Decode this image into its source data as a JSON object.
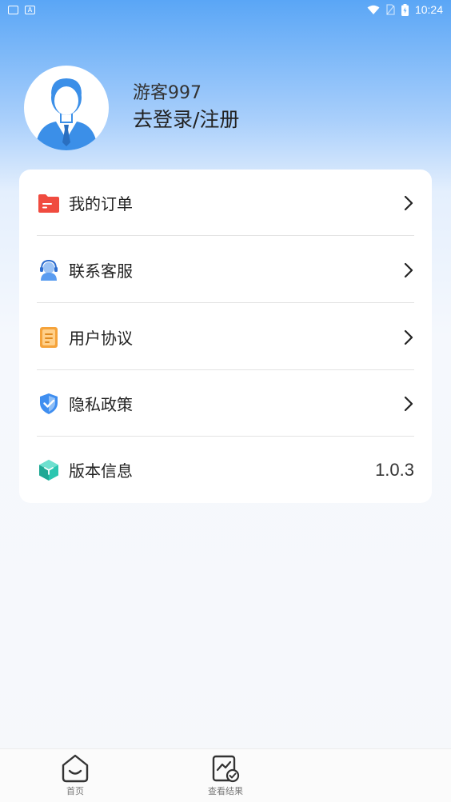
{
  "status_bar": {
    "time": "10:24",
    "left_icons": [
      "mail-icon",
      "a-app-icon"
    ],
    "right_icons": [
      "wifi-icon",
      "no-sim-icon",
      "battery-charging-icon"
    ]
  },
  "profile": {
    "username": "游客997",
    "login_link": "去登录/注册"
  },
  "menu": {
    "items": [
      {
        "label": "我的订单",
        "icon": "orders-folder-icon",
        "icon_color": "#f04b3f"
      },
      {
        "label": "联系客服",
        "icon": "customer-service-icon",
        "icon_color": "#5a9cf0"
      },
      {
        "label": "用户协议",
        "icon": "document-icon",
        "icon_color": "#f5a33a"
      },
      {
        "label": "隐私政策",
        "icon": "shield-check-icon",
        "icon_color": "#3f8ef0"
      },
      {
        "label": "版本信息",
        "icon": "cube-icon",
        "icon_color": "#2cc6b0",
        "value": "1.0.3"
      }
    ]
  },
  "tab_bar": {
    "tabs": [
      {
        "label": "首页",
        "icon": "home-smile-icon"
      },
      {
        "label": "查看结果",
        "icon": "chart-check-icon"
      }
    ]
  },
  "colors": {
    "accent_blue": "#5aa6f6",
    "text": "#222222"
  }
}
